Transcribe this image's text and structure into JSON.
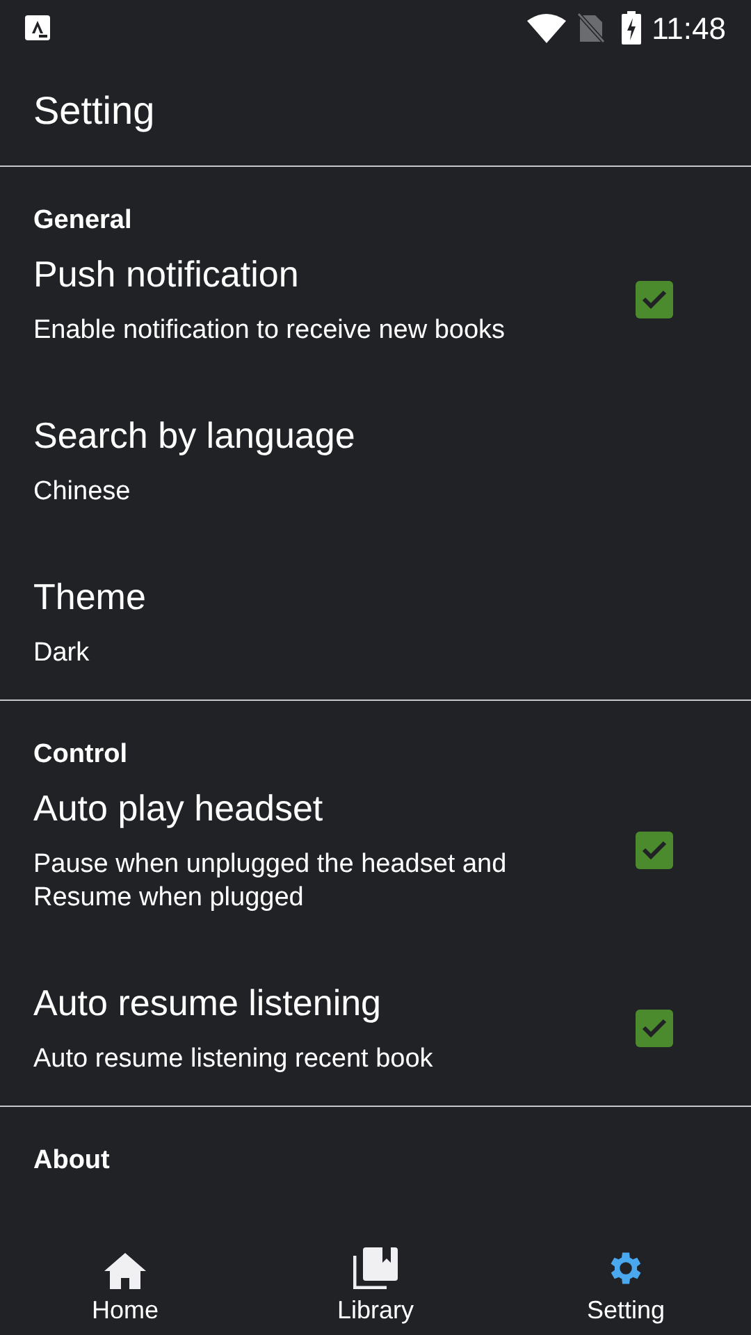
{
  "status_bar": {
    "time": "11:48"
  },
  "header": {
    "title": "Setting"
  },
  "sections": [
    {
      "label": "General",
      "items": [
        {
          "kind": "checkbox",
          "title": "Push notification",
          "subtitle": "Enable notification to receive new books",
          "checked": true
        },
        {
          "kind": "value",
          "title": "Search by language",
          "subtitle": "Chinese"
        },
        {
          "kind": "value",
          "title": "Theme",
          "subtitle": "Dark"
        }
      ]
    },
    {
      "label": "Control",
      "items": [
        {
          "kind": "checkbox",
          "title": "Auto play headset",
          "subtitle": "Pause when unplugged the headset and Resume when plugged",
          "checked": true
        },
        {
          "kind": "checkbox",
          "title": "Auto resume listening",
          "subtitle": "Auto resume listening recent book",
          "checked": true
        }
      ]
    },
    {
      "label": "About"
    }
  ],
  "bottom_nav": [
    {
      "label": "Home",
      "selected": false
    },
    {
      "label": "Library",
      "selected": false
    },
    {
      "label": "Setting",
      "selected": true
    }
  ]
}
